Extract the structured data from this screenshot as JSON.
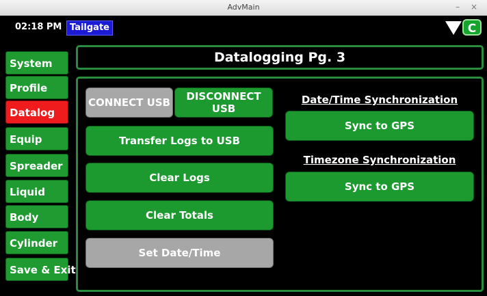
{
  "window": {
    "title": "AdvMain",
    "controls": "– ×"
  },
  "topbar": {
    "time": "02:18 PM",
    "mode": "Tailgate",
    "c_label": "C"
  },
  "nav": {
    "items": [
      {
        "label": "System"
      },
      {
        "label": "Profile"
      },
      {
        "label": "Datalog",
        "active": true
      },
      {
        "label": "Equip"
      },
      {
        "label": "Spreader"
      },
      {
        "label": "Liquid"
      },
      {
        "label": "Body"
      },
      {
        "label": "Cylinder"
      },
      {
        "label": "Save & Exit"
      }
    ]
  },
  "page": {
    "title": "Datalogging Pg. 3"
  },
  "usb": {
    "connect_label": "CONNECT USB",
    "disconnect_label": "DISCONNECT USB"
  },
  "actions": {
    "transfer_label": "Transfer Logs to USB",
    "clear_logs_label": "Clear Logs",
    "clear_totals_label": "Clear Totals",
    "set_datetime_label": "Set Date/Time"
  },
  "sync": {
    "datetime_heading": "Date/Time Synchronization",
    "datetime_button": "Sync to GPS",
    "timezone_heading": "Timezone Synchronization",
    "timezone_button": "Sync to GPS"
  },
  "colors": {
    "nav_green": "#1f9b32",
    "nav_active": "#ee1c1c",
    "panel_border": "#2a8c3c",
    "disabled_gray": "#a7a7a7",
    "mode_blue": "#1b1bd6"
  }
}
